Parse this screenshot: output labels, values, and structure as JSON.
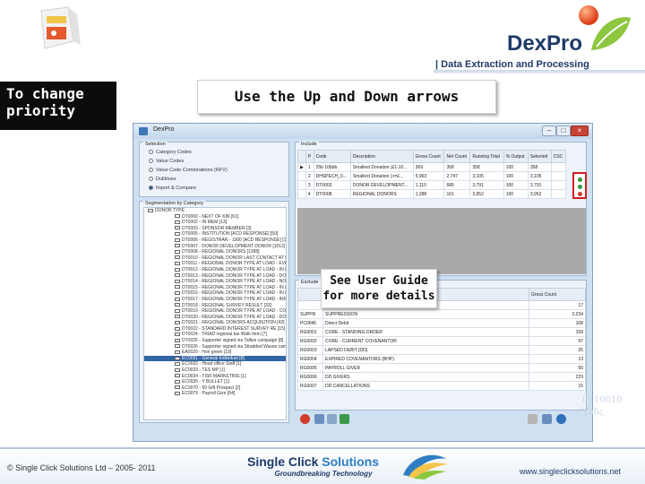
{
  "header": {
    "brand_logo": "DexPro",
    "tagline": "| Data Extraction and Processing"
  },
  "labels": {
    "side_label": "To change priority",
    "top_callout": "Use the Up and Down arrows",
    "guide_callout": "See User Guide for more details"
  },
  "app": {
    "window_title": "DexPro",
    "selection_group": "Selection",
    "selection_options": [
      "Category Codes",
      "Value Codes",
      "Value Code Combinations (RFV)",
      "Duliblues",
      "Import & Compare"
    ],
    "segmentation_group": "Segmentation by Category",
    "tree_root": "DONOR TYPE",
    "tree_items": [
      "DT0000 - NEXT OF KIN [61]",
      "DT0002 - IN MEM [13]",
      "DT0003 - SPONSOR MEMBER [3]",
      "DT0005 - INSTITUTION [ACD RESPONSE] [50]",
      "DT0006 - REGISTRAR - 1000 [ACD RESPONSE] [1207]",
      "DT0007 - DONOR DEVELOPMENT DONOR [1012]",
      "DT0008 - REGIONAL DONORS [1288]",
      "DT0010 - REGIONAL DONOR LAST CONTACT AT LOAD",
      "DT0011 - REGIONAL DONOR TYPE AT LOAD - EVENTS",
      "DT0012 - REGIONAL DONOR TYPE AT LOAD - IN MEM",
      "DT0013 - REGIONAL DONOR TYPE AT LOAD - DONOR",
      "DT0014 - REGIONAL DONOR TYPE AT LOAD - NOK CO",
      "DT0015 - REGIONAL DONOR TYPE AT LOAD - IN MEM",
      "DT0016 - REGIONAL DONOR TYPE AT LOAD - IN MEM",
      "DT0017 - REGIONAL DONOR TYPE AT LOAD - IRREG REL",
      "DT0018 - REGIONAL SURVEY RESULT [33]",
      "DT0019 - REGIONAL DONOR TYPE AT LOAD - COMM",
      "DT0020 - REGIONAL DONOR TYPE AT LOAD - DONOR",
      "DT0021 - REGIONAL DONORS ACQUISITION [43]",
      "DT0022 - STANDARD INTEREST SURVEY RE [15]",
      "DT0024 - TRIAD regional tax Walk Item [7]",
      "DT0025 - Supporter signed via Tallies campaign [8]",
      "DT0026 - Supporter signed via Stradded Waves campaign",
      "EA0020 - Hon green [19]",
      "EC0031 - General Individual [8]",
      "EC0032 - Head office Staff [1]",
      "EC0033 - TES MP [1]",
      "EC0034 - TISK MARKETING [1]",
      "EC0035 - Y BULLET [1]",
      "EC0070 - 50 Gift Prospect [2]",
      "EC0079 - Payroll Givn [64]"
    ],
    "selected_tree_index": 24,
    "include_group": "Include",
    "include_columns": [
      "P",
      "Code",
      "Description",
      "Gross Count",
      "Net Count",
      "Running Total",
      "% Output",
      "Selected",
      "CSC"
    ],
    "include_rows": [
      [
        "1",
        "25b 10bbb",
        "Smallest Donation (£1-10...",
        "369",
        "358",
        "358",
        "100",
        "358",
        ""
      ],
      [
        "2",
        "DHSPECH_0...",
        "Smallest Donation (>=£...",
        "5,963",
        "2,747",
        "3,105",
        "100",
        "3,105",
        ""
      ],
      [
        "3",
        "DT0003",
        "DONOR DEVELOPMENT...",
        "1,110",
        "686",
        "3,791",
        "100",
        "3,791",
        ""
      ],
      [
        "4",
        "DT0008",
        "REGIONAL DONORS",
        "1,288",
        "161",
        "3,952",
        "100",
        "3,952",
        ""
      ]
    ],
    "exclude_group": "Exclude",
    "exclude_columns": [
      "",
      "Gross Count"
    ],
    "exclude_rows": [
      [
        "",
        "",
        "17"
      ],
      [
        "SUPPR",
        "SUPPRESSION",
        "2,234"
      ],
      [
        "PC0045",
        "Direct Debit",
        "108"
      ],
      [
        "RG0001",
        "CORE - STANDING ORDER",
        "158"
      ],
      [
        "RG0002",
        "CORE - CURRENT COVENANTOR",
        "97"
      ],
      [
        "RG0003",
        "LAPSED DEBIT [DD]",
        "25"
      ],
      [
        "RG0004",
        "EXPIRED COVENANTORS (BHP)",
        "13"
      ],
      [
        "RG0005",
        "PAYROLL GIVER",
        "50"
      ],
      [
        "RG0006",
        "DD GIVERS",
        "229"
      ],
      [
        "RG0007",
        "DD CANCELLATIONS",
        "15"
      ]
    ]
  },
  "footer": {
    "copyright": "© Single Click Solutions Ltd – 2005- 2011",
    "brand_name_dark": "Single Click ",
    "brand_name_blue": "Solutions",
    "brand_tagline": "Groundbreaking Technology",
    "website": "www.singleclicksolutions.net",
    "deco_digits": "0110010 Υόδς"
  },
  "colors": {
    "side_label_bg": "#0c0c0c",
    "brand_blue": "#1f3a68",
    "accent_red": "#d21e1e",
    "accent_green": "#2f9a3f"
  }
}
